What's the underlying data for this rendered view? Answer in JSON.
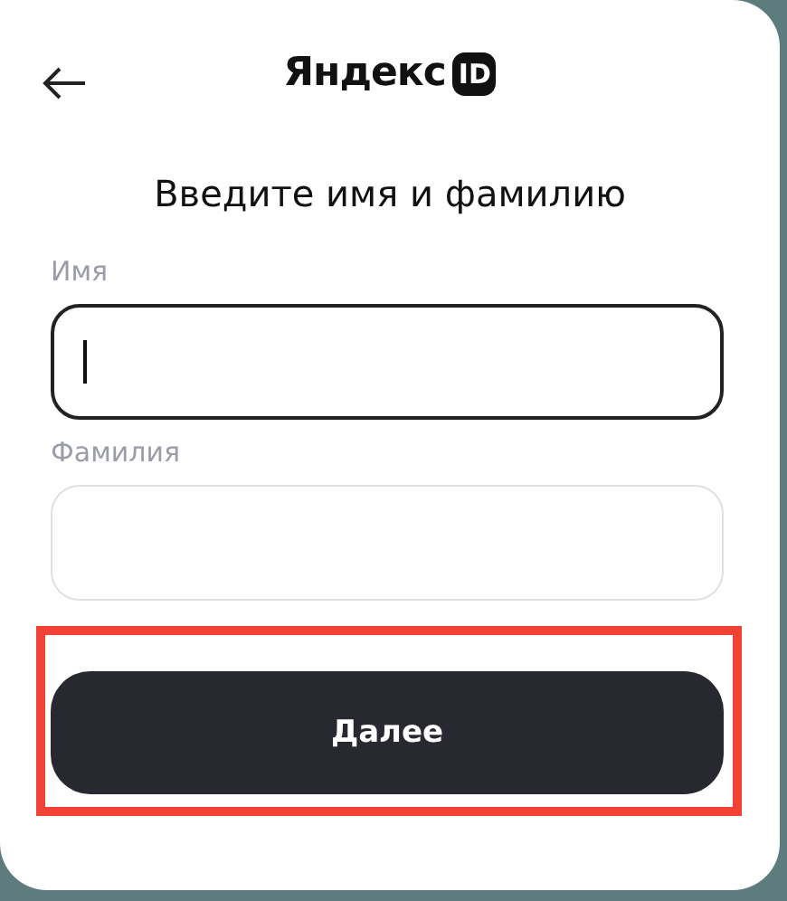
{
  "header": {
    "logo": {
      "wordmark": "Яндекс",
      "badge": "ID"
    }
  },
  "title": "Введите имя и фамилию",
  "fields": [
    {
      "label": "Имя",
      "focused": true
    },
    {
      "label": "Фамилия",
      "focused": false
    }
  ],
  "button": {
    "label": "Далее",
    "highlighted": true
  }
}
